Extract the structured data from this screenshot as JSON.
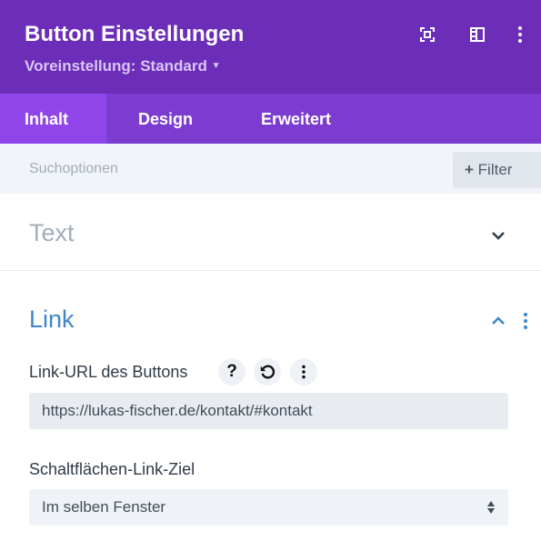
{
  "header": {
    "title": "Button Einstellungen",
    "preset": "Voreinstellung: Standard",
    "icons": [
      "focus-icon",
      "sidebar-toggle-icon",
      "more-vertical-icon"
    ]
  },
  "tabs": [
    {
      "label": "Inhalt",
      "active": true
    },
    {
      "label": "Design"
    },
    {
      "label": "Erweitert"
    }
  ],
  "search": {
    "placeholder": "Suchoptionen",
    "filter_label": "Filter"
  },
  "sections": {
    "text": {
      "title": "Text",
      "expanded": false
    },
    "link": {
      "title": "Link",
      "expanded": true,
      "url_label": "Link-URL des Buttons",
      "url_value": "https://lukas-fischer.de/kontakt/#kontakt",
      "target_label": "Schaltflächen-Link-Ziel",
      "target_value": "Im selben Fenster"
    }
  },
  "colors": {
    "header": "#6c2eb9",
    "tabs": "#7b3ccf",
    "active_tab": "#8f45ea",
    "link_title": "#3e86c9"
  }
}
